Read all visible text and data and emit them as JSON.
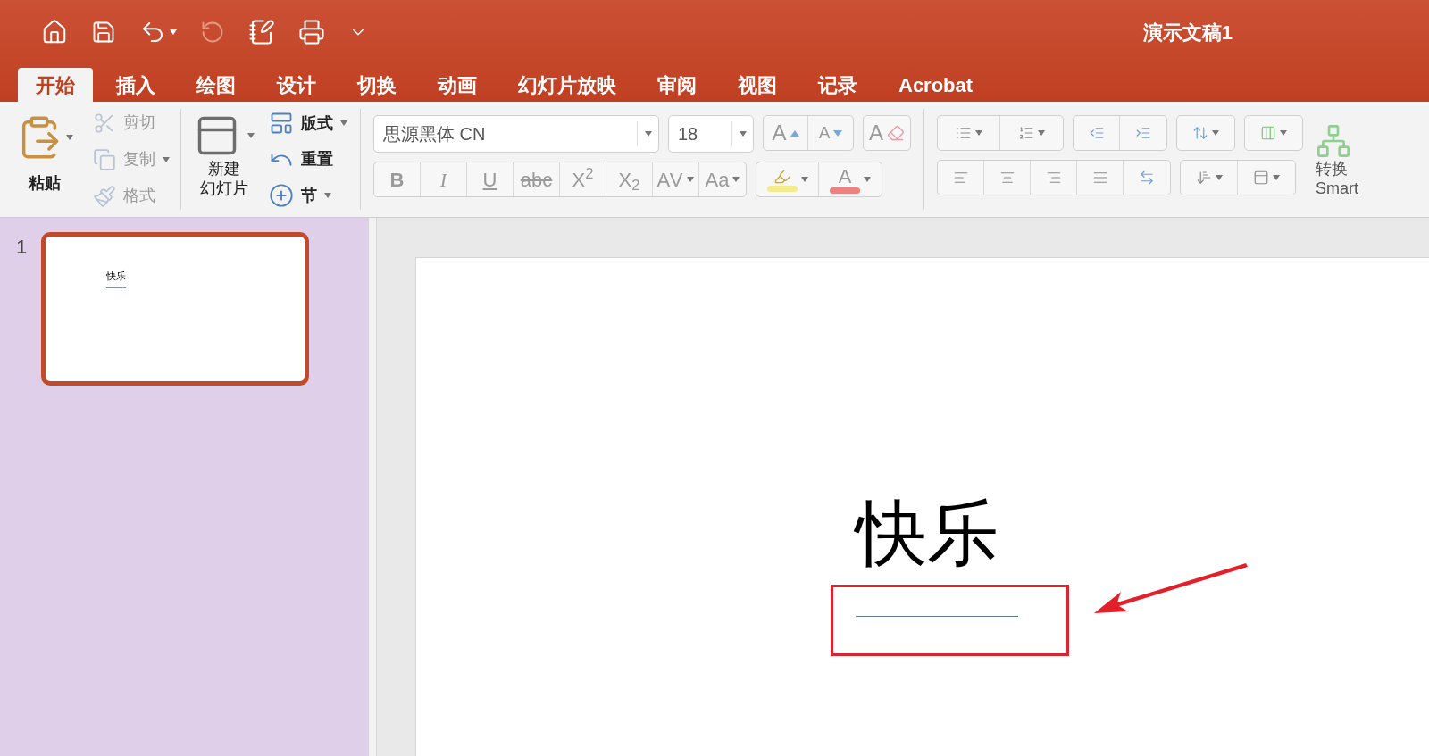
{
  "title": "演示文稿1",
  "tabs": [
    {
      "label": "开始",
      "selected": true
    },
    {
      "label": "插入",
      "selected": false
    },
    {
      "label": "绘图",
      "selected": false
    },
    {
      "label": "设计",
      "selected": false
    },
    {
      "label": "切换",
      "selected": false
    },
    {
      "label": "动画",
      "selected": false
    },
    {
      "label": "幻灯片放映",
      "selected": false
    },
    {
      "label": "审阅",
      "selected": false
    },
    {
      "label": "视图",
      "selected": false
    },
    {
      "label": "记录",
      "selected": false
    },
    {
      "label": "Acrobat",
      "selected": false
    }
  ],
  "clipboard": {
    "paste": "粘贴",
    "items": [
      {
        "label": "剪切",
        "kind": "cut",
        "disabled": true,
        "dropdown": false
      },
      {
        "label": "复制",
        "kind": "copy",
        "disabled": true,
        "dropdown": true
      },
      {
        "label": "格式",
        "kind": "format",
        "disabled": true,
        "dropdown": false
      }
    ]
  },
  "slides_group": {
    "new_slide": [
      "新建",
      "幻灯片"
    ],
    "items": [
      {
        "label": "版式",
        "kind": "layout",
        "dropdown": true
      },
      {
        "label": "重置",
        "kind": "reset",
        "dropdown": false
      },
      {
        "label": "节",
        "kind": "section",
        "dropdown": true
      }
    ]
  },
  "font": {
    "name": "思源黑体 CN",
    "size": "18",
    "grow": "A",
    "shrink": "A",
    "clear": "A",
    "styles": [
      {
        "label": "B",
        "kind": "bold"
      },
      {
        "label": "I",
        "kind": "italic"
      },
      {
        "label": "U",
        "kind": "underline"
      },
      {
        "label": "abc",
        "kind": "strike"
      },
      {
        "label": "X$^{2}$",
        "kind": "plain"
      },
      {
        "label": "X$_{2}$",
        "kind": "plain"
      },
      {
        "label": "AV",
        "kind": "spacing"
      },
      {
        "label": "Aa",
        "kind": "case"
      }
    ],
    "highlight": {
      "color": "#f3ec8a"
    },
    "font_color": {
      "label": "A",
      "color": "#ef8080"
    }
  },
  "smartart": [
    "转换",
    "Smart"
  ],
  "thumbnails": [
    {
      "number": "1",
      "selected": true,
      "title": "快乐"
    }
  ],
  "slide": {
    "title": "快乐"
  }
}
